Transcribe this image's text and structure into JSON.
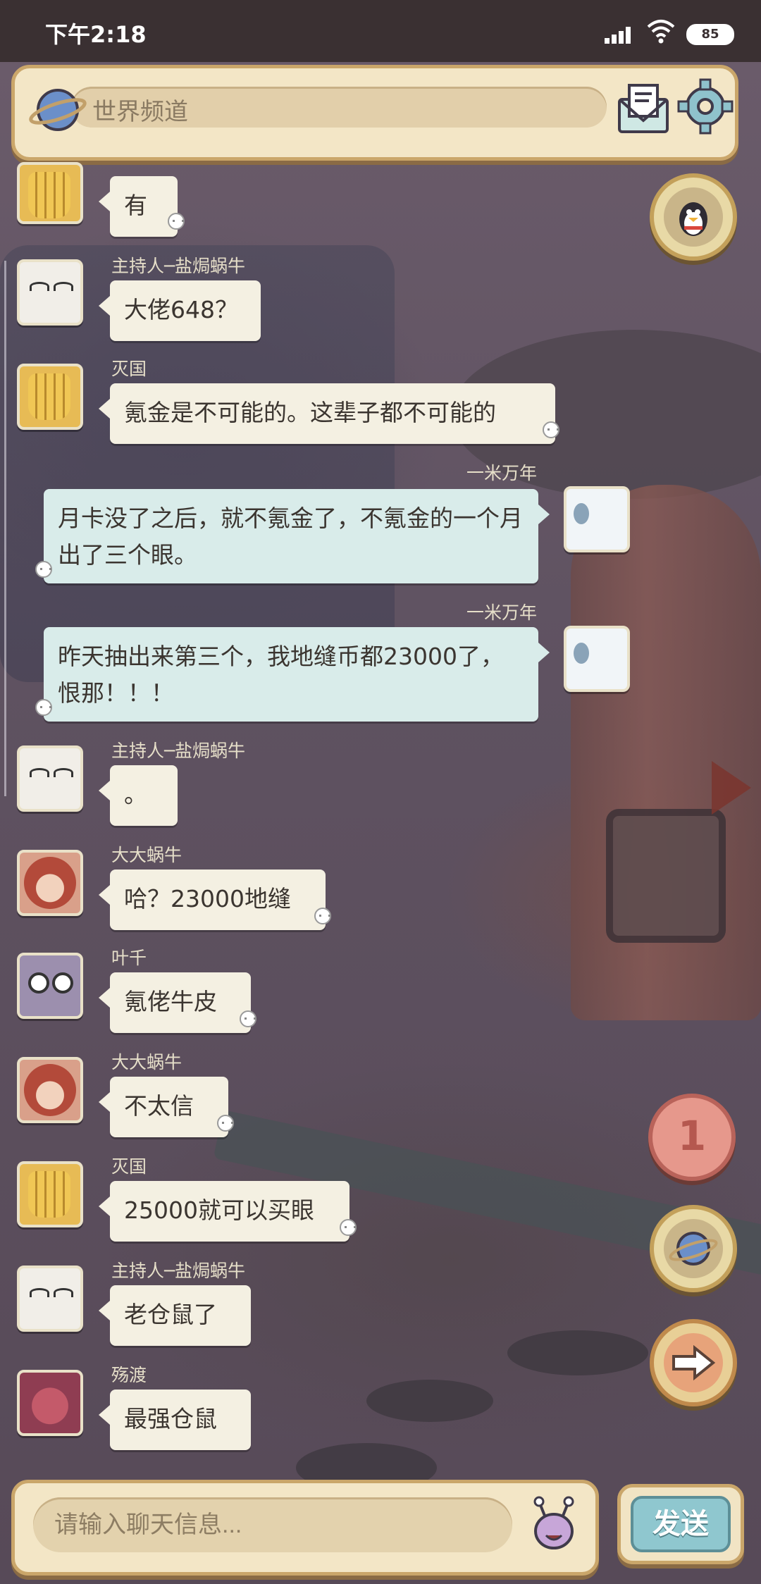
{
  "status_bar": {
    "time": "下午2:18",
    "battery": "85"
  },
  "channel": {
    "label": "世界频道"
  },
  "messages": [
    {
      "user": "",
      "text": "有",
      "side": "left",
      "avatar": "glove-avatar"
    },
    {
      "user": "主持人─盐焗蜗牛",
      "text": "大佬648？",
      "side": "left",
      "avatar": "snail-avatar"
    },
    {
      "user": "灭国",
      "text": "氪金是不可能的。这辈子都不可能的",
      "side": "left",
      "avatar": "glove-avatar"
    },
    {
      "user": "一米万年",
      "text": "月卡没了之后，就不氪金了，不氪金的一个月出了三个眼。",
      "side": "right",
      "avatar": "ghost-avatar"
    },
    {
      "user": "一米万年",
      "text": "昨天抽出来第三个，我地缝币都23000了，恨那！！！",
      "side": "right",
      "avatar": "ghost-avatar"
    },
    {
      "user": "主持人─盐焗蜗牛",
      "text": "。",
      "side": "left",
      "avatar": "snail-avatar"
    },
    {
      "user": "大大蜗牛",
      "text": "哈？23000地缝",
      "side": "left",
      "avatar": "redhair-avatar"
    },
    {
      "user": "叶千",
      "text": "氪佬牛皮",
      "side": "left",
      "avatar": "robot-avatar"
    },
    {
      "user": "大大蜗牛",
      "text": "不太信",
      "side": "left",
      "avatar": "redhair-avatar"
    },
    {
      "user": "灭国",
      "text": "25000就可以买眼",
      "side": "left",
      "avatar": "glove-avatar"
    },
    {
      "user": "主持人─盐焗蜗牛",
      "text": "老仓鼠了",
      "side": "left",
      "avatar": "snail-avatar"
    },
    {
      "user": "殇渡",
      "text": "最强仓鼠",
      "side": "left",
      "avatar": "pink-avatar"
    }
  ],
  "unread_badge": "1",
  "input": {
    "placeholder": "请输入聊天信息..."
  },
  "send_button": {
    "label": "发送"
  }
}
